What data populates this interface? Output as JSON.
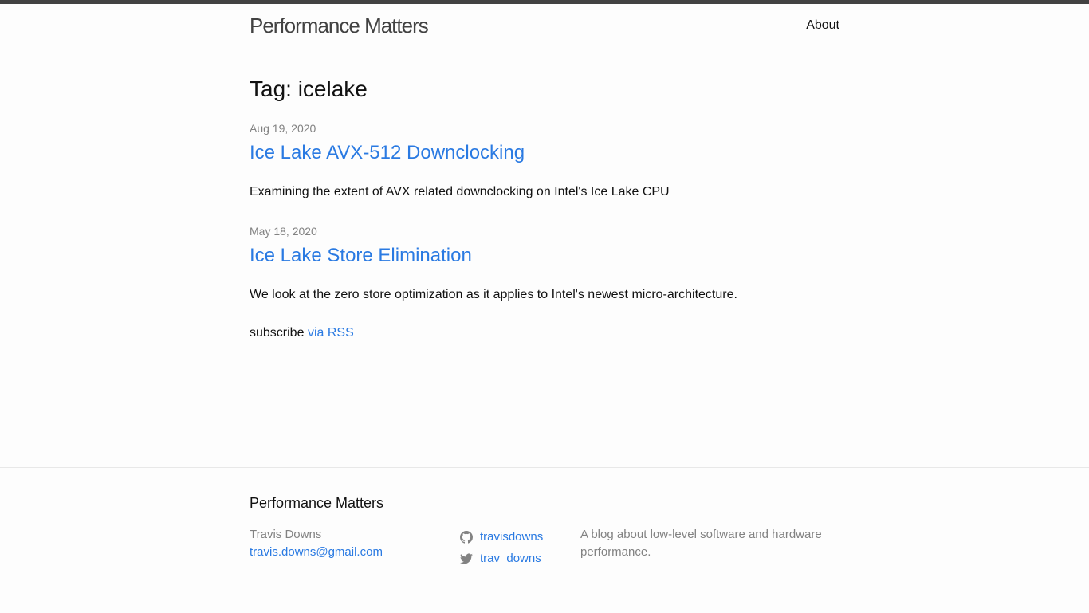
{
  "header": {
    "site_title": "Performance Matters",
    "nav": [
      {
        "label": "About"
      }
    ]
  },
  "page": {
    "heading": "Tag: icelake"
  },
  "posts": [
    {
      "date": "Aug 19, 2020",
      "title": "Ice Lake AVX-512 Downclocking",
      "excerpt": "Examining the extent of AVX related downclocking on Intel's Ice Lake CPU"
    },
    {
      "date": "May 18, 2020",
      "title": "Ice Lake Store Elimination",
      "excerpt": "We look at the zero store optimization as it applies to Intel's newest micro-architecture."
    }
  ],
  "subscribe": {
    "prefix": "subscribe",
    "link_label": "via RSS"
  },
  "footer": {
    "heading": "Performance Matters",
    "author": "Travis Downs",
    "email": "travis.downs@gmail.com",
    "github": {
      "username": "travisdowns",
      "icon": "github-icon"
    },
    "twitter": {
      "username": "trav_downs",
      "icon": "twitter-icon"
    },
    "description": "A blog about low-level software and hardware performance."
  },
  "colors": {
    "link": "#2a7ae2",
    "meta": "#828282",
    "header_border": "#424242",
    "background": "#fdfdfd"
  }
}
